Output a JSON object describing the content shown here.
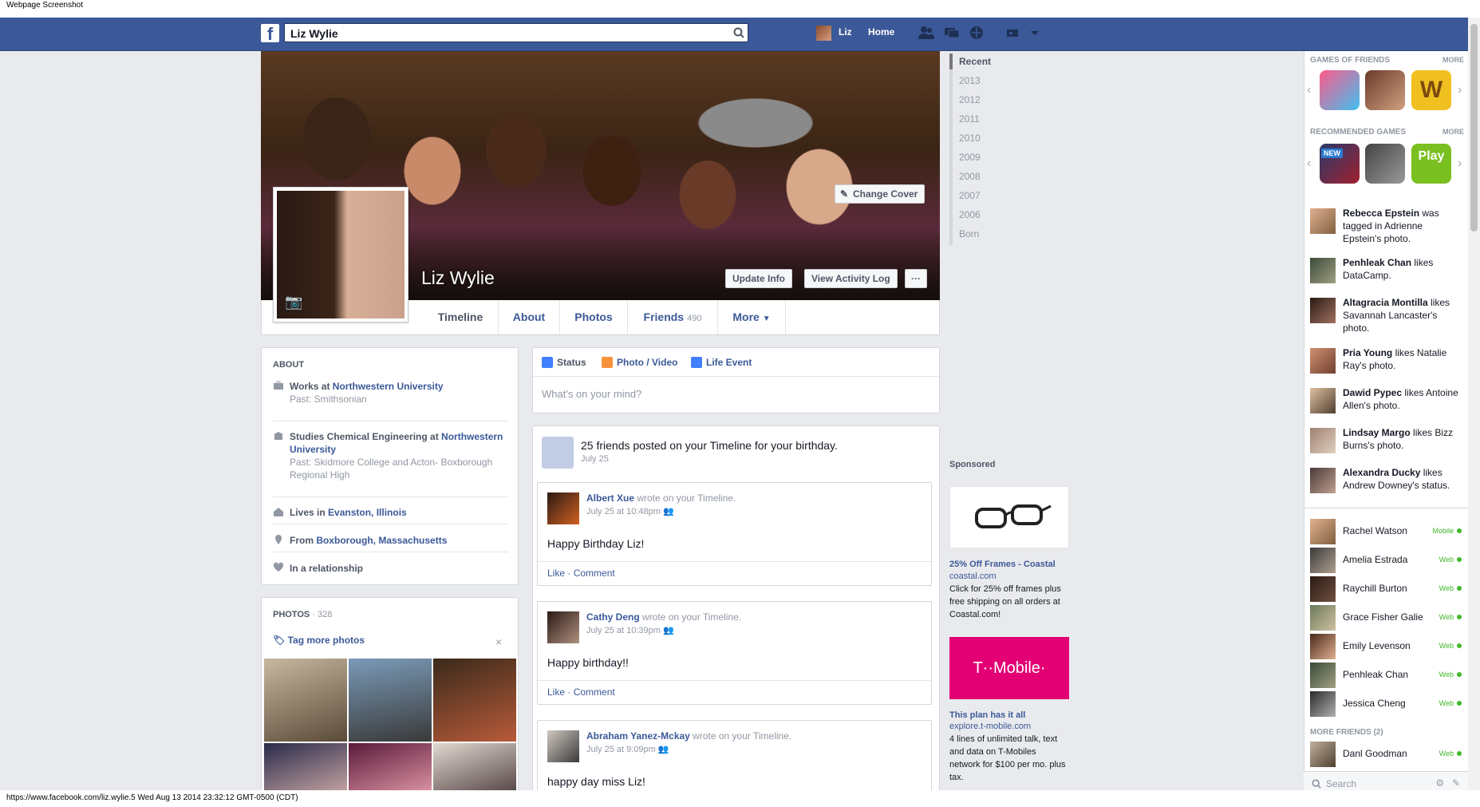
{
  "capture_title": "Webpage Screenshot",
  "header": {
    "search_value": "Liz Wylie",
    "me_name": "Liz",
    "home_label": "Home",
    "icons": [
      "friend-requests-icon",
      "messages-icon",
      "notifications-icon",
      "privacy-icon",
      "account-menu-icon"
    ]
  },
  "cover": {
    "change_cover_label": "Change Cover",
    "profile_name": "Liz Wylie",
    "update_info_label": "Update Info",
    "activity_log_label": "View Activity Log",
    "more_label": "···"
  },
  "nav_tabs": [
    {
      "label": "Timeline"
    },
    {
      "label": "About"
    },
    {
      "label": "Photos"
    },
    {
      "label": "Friends",
      "count": "490"
    },
    {
      "label": "More"
    }
  ],
  "about": {
    "heading": "ABOUT",
    "work_prefix": "Works at ",
    "work_link": "Northwestern University",
    "work_past": "Past: Smithsonian",
    "study_prefix": "Studies Chemical Engineering at ",
    "study_link": "Northwestern University",
    "study_past": "Past: Skidmore College and Acton- Boxborough Regional High",
    "lives_prefix": "Lives in ",
    "lives_link": "Evanston, Illinois",
    "from_prefix": "From ",
    "from_link": "Boxborough, Massachusetts",
    "relationship": "In a relationship"
  },
  "photos": {
    "heading": "PHOTOS",
    "count": " · 328",
    "tag_more": "Tag more photos",
    "close": "×"
  },
  "composer": {
    "tabs": [
      "Status",
      "Photo / Video",
      "Life Event"
    ],
    "placeholder": "What's on your mind?"
  },
  "birthday": {
    "title": "25 friends posted on your Timeline for your birthday.",
    "date": "July 25",
    "posts": [
      {
        "name": "Albert Xue",
        "suffix": " wrote on your Timeline.",
        "time": "July 25 at 10:48pm",
        "message": "Happy Birthday Liz!",
        "like": "Like",
        "comment": "Comment"
      },
      {
        "name": "Cathy Deng",
        "suffix": " wrote on your Timeline.",
        "time": "July 25 at 10:39pm",
        "message": "Happy birthday!!",
        "like": "Like",
        "comment": "Comment"
      },
      {
        "name": "Abraham Yanez-Mckay",
        "suffix": " wrote on your Timeline.",
        "time": "July 25 at 9:09pm",
        "message": "happy day miss Liz!",
        "like": "Like",
        "comment": "Comment"
      }
    ]
  },
  "scrubber": [
    "Recent",
    "2013",
    "2012",
    "2011",
    "2010",
    "2009",
    "2008",
    "2007",
    "2006",
    "Born"
  ],
  "ads": {
    "sponsored": "Sponsored",
    "ad1_title": "25% Off Frames - Coastal",
    "ad1_url": "coastal.com",
    "ad1_text": "Click for 25% off frames plus free shipping on all orders at Coastal.com!",
    "ad2_logo": "T··Mobile·",
    "ad2_title": "This plan has it all",
    "ad2_url": "explore.t-mobile.com",
    "ad2_text": "4 lines of unlimited talk, text and data on T-Mobiles network for $100 per mo. plus tax."
  },
  "ticker": {
    "games_friends": "GAMES OF FRIENDS",
    "recommended": "RECOMMENDED GAMES",
    "more": "MORE",
    "new_badge": "NEW",
    "play_label": "Play",
    "items": [
      {
        "name": "Rebecca Epstein",
        "text": " was tagged in Adrienne Epstein's photo."
      },
      {
        "name": "Penhleak Chan",
        "text": " likes DataCamp."
      },
      {
        "name": "Altagracia Montilla",
        "text": " likes Savannah Lancaster's photo."
      },
      {
        "name": "Pria Young",
        "text": " likes Natalie Ray's photo."
      },
      {
        "name": "Dawid Pypec",
        "text": " likes Antoine Allen's photo."
      },
      {
        "name": "Lindsay Margo",
        "text": " likes Bizz Burns's photo."
      },
      {
        "name": "Alexandra Ducky",
        "text": " likes Andrew Downey's status."
      }
    ],
    "chat": [
      {
        "name": "Rachel Watson",
        "status": "Mobile"
      },
      {
        "name": "Amelia Estrada",
        "status": "Web"
      },
      {
        "name": "Raychill Burton",
        "status": "Web"
      },
      {
        "name": "Grace Fisher Galie",
        "status": "Web"
      },
      {
        "name": "Emily Levenson",
        "status": "Web"
      },
      {
        "name": "Penhleak Chan",
        "status": "Web"
      },
      {
        "name": "Jessica Cheng",
        "status": "Web"
      }
    ],
    "more_friends": "MORE FRIENDS (2)",
    "more_chat": {
      "name": "Danl Goodman",
      "status": "Web"
    },
    "search_placeholder": "Search"
  },
  "status_bar": "https://www.facebook.com/liz.wylie.5 Wed Aug 13 2014 23:32:12 GMT-0500 (CDT)"
}
